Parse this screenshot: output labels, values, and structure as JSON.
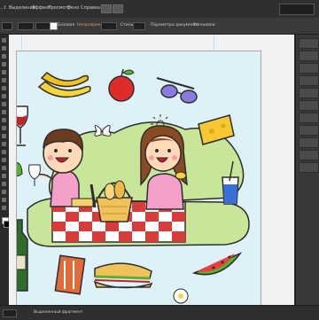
{
  "menu": {
    "items": [
      "...t",
      "Выделение",
      "Эффект",
      "Просмотр",
      "Окно",
      "Справка"
    ]
  },
  "options": {
    "style_label": "Базовая",
    "opacity_label": "Непрозрачность",
    "style_short": "Стиль",
    "doc_setup": "Параметры документа",
    "preferences": "Установки"
  },
  "status": {
    "text": "Выделенный фрагмент"
  },
  "colors": {
    "chrome": "#2b2b2b",
    "artboard_bg": "#dff1f8"
  }
}
